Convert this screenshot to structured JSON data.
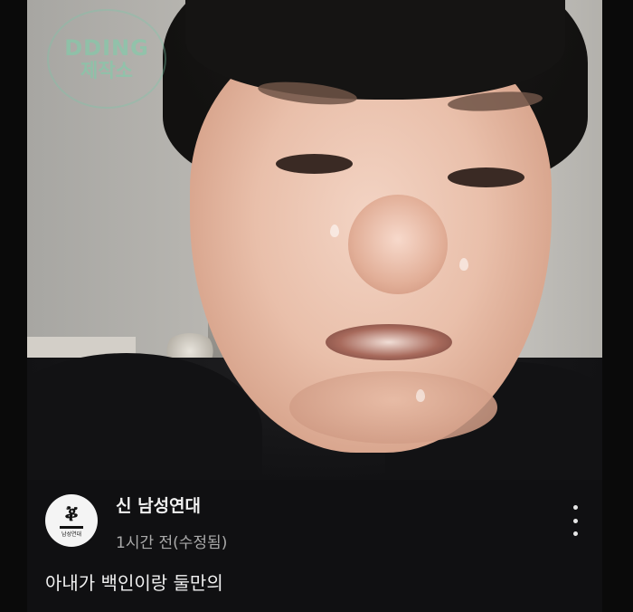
{
  "watermark": {
    "line1": "DDING",
    "line2": "제작소"
  },
  "post": {
    "channel_name": "신 남성연대",
    "timestamp": "1시간 전(수정됨)",
    "body_line1": "아내가 백인이랑 둘만의",
    "body_line2": "",
    "avatar_logo_text": "남성연대"
  },
  "icons": {
    "menu": "more-vert-icon"
  },
  "colors": {
    "background": "#0a0a0a",
    "card": "#101012",
    "text_primary": "#f1f1f1",
    "text_secondary": "#aaaaaa",
    "watermark": "#78d2aa"
  }
}
